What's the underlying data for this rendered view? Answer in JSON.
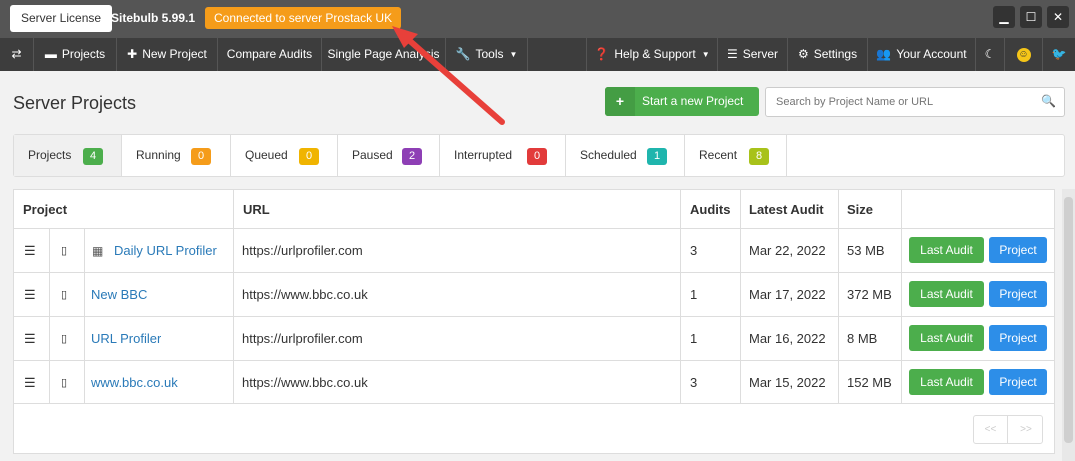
{
  "titlebar": {
    "license_label": "Server License",
    "app_version": "Sitebulb 5.99.1",
    "connection_status": "Connected to server Prostack UK",
    "status_color": "#f59c1a"
  },
  "navbar": {
    "toggle_icon": "swap-arrows-icon",
    "items": [
      {
        "label": "Projects",
        "icon": "folder-icon"
      },
      {
        "label": "New Project",
        "icon": "plus-icon"
      },
      {
        "label": "Compare Audits"
      },
      {
        "label": "Single Page Analysis"
      },
      {
        "label": "Tools",
        "icon": "wrench-icon"
      },
      {
        "label": "Help & Support",
        "icon": "question-circle-icon"
      },
      {
        "label": "Server",
        "icon": "server-icon"
      },
      {
        "label": "Settings",
        "icon": "gears-icon"
      },
      {
        "label": "Your Account",
        "icon": "users-icon"
      }
    ]
  },
  "header": {
    "title": "Server Projects",
    "new_project_label": "Start a new Project",
    "search_placeholder": "Search by Project Name or URL"
  },
  "filters": [
    {
      "label": "Projects",
      "count": "4",
      "color": "#4cae4c"
    },
    {
      "label": "Running",
      "count": "0",
      "color": "#f59c1a"
    },
    {
      "label": "Queued",
      "count": "0",
      "color": "#f0b400"
    },
    {
      "label": "Paused",
      "count": "2",
      "color": "#8e3fb5"
    },
    {
      "label": "Interrupted",
      "count": "0",
      "color": "#e23b3b"
    },
    {
      "label": "Scheduled",
      "count": "1",
      "color": "#1fb5ad"
    },
    {
      "label": "Recent",
      "count": "8",
      "color": "#a8c21a"
    }
  ],
  "table": {
    "headers": {
      "project": "Project",
      "url": "URL",
      "audits": "Audits",
      "latest_audit": "Latest Audit",
      "size": "Size"
    },
    "rows": [
      {
        "name": "Daily URL Profiler",
        "url": "https://urlprofiler.com",
        "audits": "3",
        "latest": "Mar 22, 2022",
        "size": "53 MB"
      },
      {
        "name": "New BBC",
        "url": "https://www.bbc.co.uk",
        "audits": "1",
        "latest": "Mar 17, 2022",
        "size": "372 MB"
      },
      {
        "name": "URL Profiler",
        "url": "https://urlprofiler.com",
        "audits": "1",
        "latest": "Mar 16, 2022",
        "size": "8 MB"
      },
      {
        "name": "www.bbc.co.uk",
        "url": "https://www.bbc.co.uk",
        "audits": "3",
        "latest": "Mar 15, 2022",
        "size": "152 MB"
      }
    ],
    "last_audit_label": "Last Audit",
    "project_label": "Project"
  },
  "pager": {
    "prev": "<<",
    "next": ">>"
  }
}
